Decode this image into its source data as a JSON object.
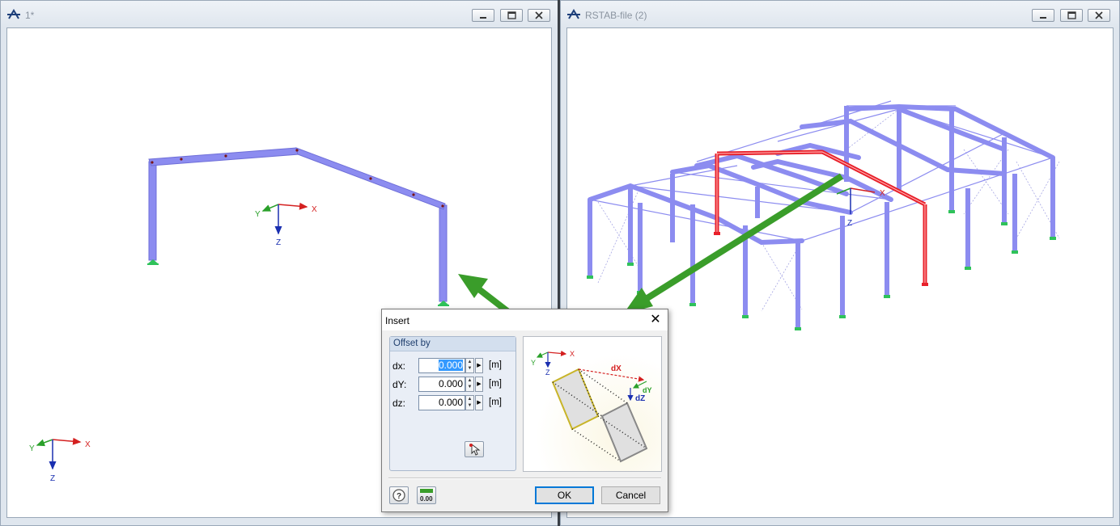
{
  "windows": {
    "left": {
      "title": "1*"
    },
    "right": {
      "title": "RSTAB-file (2)"
    }
  },
  "axes": {
    "x": "X",
    "y": "Y",
    "z": "Z"
  },
  "dialog": {
    "title": "Insert",
    "group_title": "Offset by",
    "fields": [
      {
        "label": "dx:",
        "value": "0.000",
        "unit": "[m]"
      },
      {
        "label": "dY:",
        "value": "0.000",
        "unit": "[m]"
      },
      {
        "label": "dz:",
        "value": "0.000",
        "unit": "[m]"
      }
    ],
    "preview": {
      "dx": "dX",
      "dy": "dY",
      "dz": "dZ"
    },
    "ok_label": "OK",
    "cancel_label": "Cancel",
    "calculator_text": "0.00"
  },
  "colors": {
    "member": "#8c8cf0",
    "selected": "#e8202a",
    "arrow": "#3a9d2a",
    "support": "#2fc25a"
  }
}
